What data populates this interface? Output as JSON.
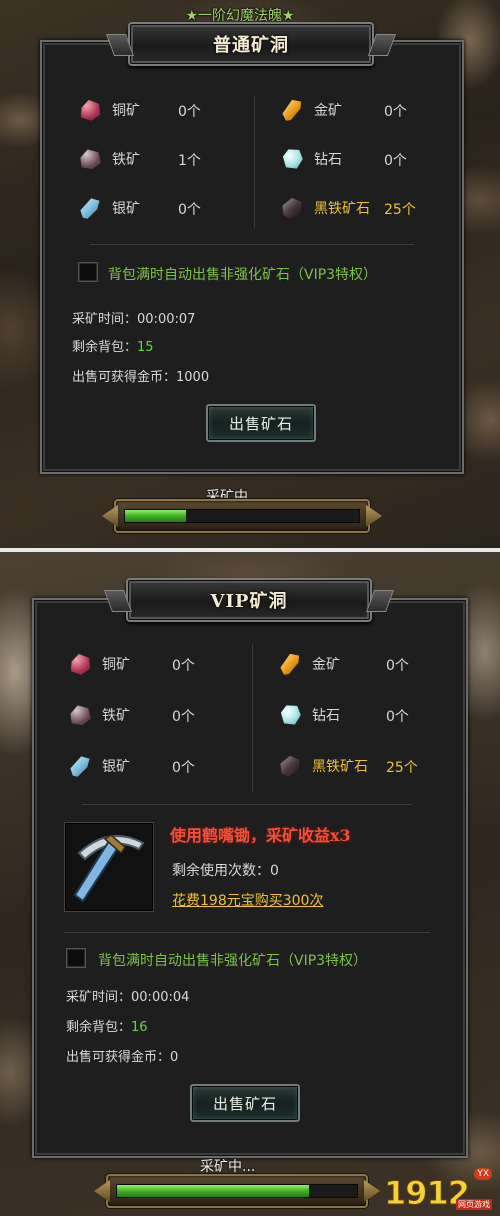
{
  "normal": {
    "banner": "★一阶幻魔法魄★",
    "title": "普通矿洞",
    "ores": [
      {
        "name": "铜矿",
        "count": "0个",
        "icon": "copper-ore-icon"
      },
      {
        "name": "铁矿",
        "count": "1个",
        "icon": "iron-ore-icon"
      },
      {
        "name": "银矿",
        "count": "0个",
        "icon": "silver-ore-icon"
      },
      {
        "name": "金矿",
        "count": "0个",
        "icon": "gold-ore-icon"
      },
      {
        "name": "钻石",
        "count": "0个",
        "icon": "diamond-icon"
      },
      {
        "name": "黑铁矿石",
        "count": "25个",
        "icon": "black-iron-ore-icon"
      }
    ],
    "auto_sell_label": "背包满时自动出售非强化矿石（VIP3特权）",
    "mining_time_label": "采矿时间：",
    "mining_time_value": "00:00:07",
    "bag_label": "剩余背包：",
    "bag_value": "15",
    "gold_label": "出售可获得金币：",
    "gold_value": "1000",
    "sell_button": "出售矿石",
    "status": "采矿中...",
    "progress": 0.26
  },
  "vip": {
    "title": "VIP矿洞",
    "ores": [
      {
        "name": "铜矿",
        "count": "0个",
        "icon": "copper-ore-icon"
      },
      {
        "name": "铁矿",
        "count": "0个",
        "icon": "iron-ore-icon"
      },
      {
        "name": "银矿",
        "count": "0个",
        "icon": "silver-ore-icon"
      },
      {
        "name": "金矿",
        "count": "0个",
        "icon": "gold-ore-icon"
      },
      {
        "name": "钻石",
        "count": "0个",
        "icon": "diamond-icon"
      },
      {
        "name": "黑铁矿石",
        "count": "25个",
        "icon": "black-iron-ore-icon"
      }
    ],
    "pickaxe_promo": "使用鹤嘴锄，采矿收益x3",
    "remaining_label": "剩余使用次数：0",
    "buy_link": "花费198元宝购买300次",
    "auto_sell_label": "背包满时自动出售非强化矿石（VIP3特权）",
    "mining_time_label": "采矿时间：",
    "mining_time_value": "00:00:04",
    "bag_label": "剩余背包：",
    "bag_value": "16",
    "gold_label": "出售可获得金币：",
    "gold_value": "0",
    "sell_button": "出售矿石",
    "status": "采矿中...",
    "progress": 0.8
  },
  "watermark": {
    "number": "1912",
    "badge": "YX",
    "sub": "网页游戏"
  },
  "colors": {
    "gold_text": "#f2c035",
    "green_value": "#5edb3f",
    "green_label": "#7cc24a",
    "promo_red": "#f0503a"
  }
}
